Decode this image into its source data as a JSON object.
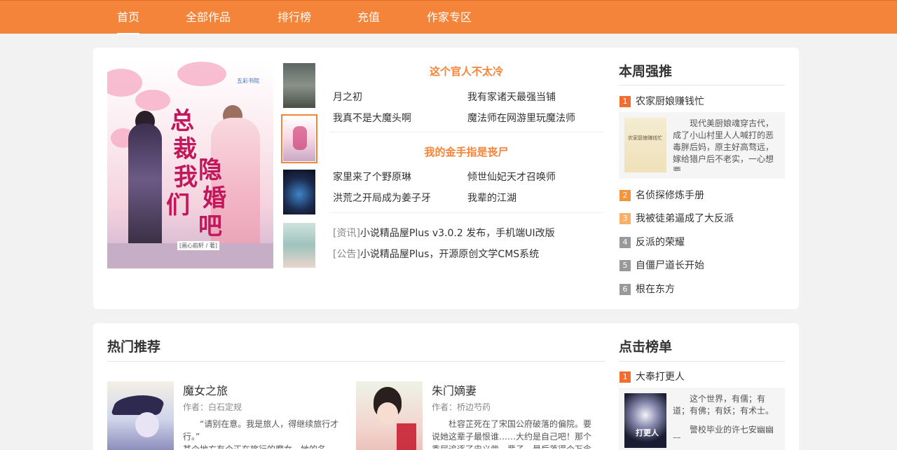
{
  "nav": {
    "items": [
      "首页",
      "全部作品",
      "排行榜",
      "充值",
      "作家专区"
    ],
    "active": 0,
    "color": "#f5843b"
  },
  "featured": {
    "cover_title": "总裁我们隐婚吧",
    "cover_lines": [
      "总",
      "裁",
      "我",
      "们",
      "隐",
      "婚",
      "吧"
    ],
    "cover_author": "[画心韵轩 / 著]",
    "cover_logo": "五彩书院",
    "thumbs_selected": 1
  },
  "groups": [
    {
      "title": "这个官人不太冷",
      "books": [
        "月之初",
        "我有家诸天最强当铺",
        "我真不是大魔头啊",
        "魔法师在网游里玩魔法师"
      ]
    },
    {
      "title": "我的金手指是丧尸",
      "books": [
        "家里来了个野原琳",
        "倾世仙妃天才召唤师",
        "洪荒之开局成为姜子牙",
        "我辈的江湖"
      ]
    }
  ],
  "news": [
    {
      "tag": "[资讯]",
      "text": "小说精品屋Plus v3.0.2 发布，手机端UI改版"
    },
    {
      "tag": "[公告]",
      "text": "小说精品屋Plus，开源原创文学CMS系统"
    }
  ],
  "weekly": {
    "title": "本周强推",
    "items": [
      "农家厨娘赚钱忙",
      "名侦探修炼手册",
      "我被徒弟逼成了大反派",
      "反派的荣耀",
      "自僵尸道长开始",
      "根在东方"
    ],
    "top_desc": "现代美厨娘魂穿古代，成了小山村里人人喊打的恶毒胖后妈，原主好高骛远，嫁给猎户后不老实，一心想要",
    "top_cover_text": "农家厨娘赚钱忙"
  },
  "hot": {
    "title": "热门推荐",
    "books": [
      {
        "name": "魔女之旅",
        "author": "作者：白石定规",
        "desc": "“请别在意。我是旅人，得继续旅行才行。”\n其个地方有个正在旅行的魔女，她的名"
      },
      {
        "name": "朱门嫡妻",
        "author": "作者：桥边芍药",
        "desc": "杜容芷死在了宋国公府破落的偏院。要说她这辈子最恨谁……大约是自己吧！那个委屈追逐了忠义凿一辈子，最后落得个万念"
      }
    ]
  },
  "clicks": {
    "title": "点击榜单",
    "top": "大奉打更人",
    "top_desc": "这个世界，有儒；有道；有佛；有妖；有术士。",
    "top_desc2": "警校毕业的许七安幽幽醒",
    "top_cover_text": "打更人"
  },
  "labels": {
    "ranks": [
      "1",
      "2",
      "3",
      "4",
      "5",
      "6"
    ]
  }
}
